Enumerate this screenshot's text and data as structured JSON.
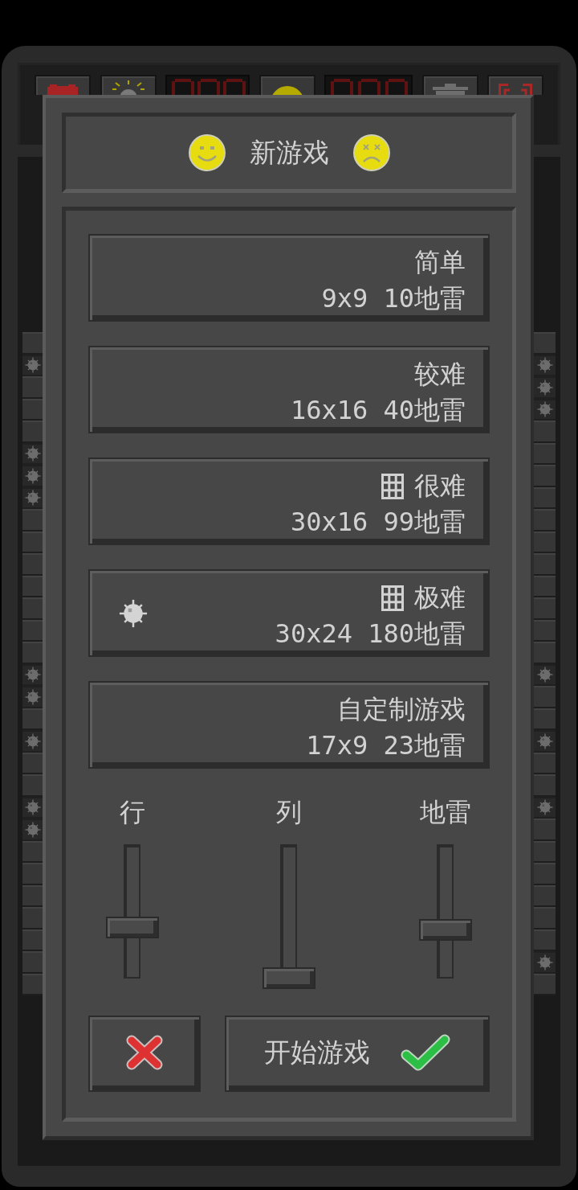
{
  "board": {
    "left_column": [
      {
        "mine": false
      },
      {
        "mine": true
      },
      {
        "mine": false
      },
      {
        "mine": false
      },
      {
        "mine": false
      },
      {
        "mine": true
      },
      {
        "mine": true
      },
      {
        "mine": true
      },
      {
        "mine": false
      },
      {
        "mine": false
      },
      {
        "mine": false
      },
      {
        "mine": false
      },
      {
        "mine": false
      },
      {
        "mine": false
      },
      {
        "mine": false
      },
      {
        "mine": true
      },
      {
        "mine": true
      },
      {
        "mine": false
      },
      {
        "mine": true
      },
      {
        "mine": false
      },
      {
        "mine": false
      },
      {
        "mine": true
      },
      {
        "mine": true
      },
      {
        "mine": false
      },
      {
        "mine": false
      },
      {
        "mine": false
      },
      {
        "mine": false
      },
      {
        "mine": false
      },
      {
        "mine": false
      },
      {
        "mine": false
      }
    ],
    "right_column": [
      {
        "mine": false
      },
      {
        "mine": true
      },
      {
        "mine": true
      },
      {
        "mine": true
      },
      {
        "mine": false
      },
      {
        "mine": false
      },
      {
        "mine": false
      },
      {
        "mine": false
      },
      {
        "mine": false
      },
      {
        "mine": false
      },
      {
        "mine": false
      },
      {
        "mine": false
      },
      {
        "mine": false
      },
      {
        "mine": false
      },
      {
        "mine": false
      },
      {
        "mine": true
      },
      {
        "mine": false
      },
      {
        "mine": false
      },
      {
        "mine": true
      },
      {
        "mine": false
      },
      {
        "mine": false
      },
      {
        "mine": true
      },
      {
        "mine": false
      },
      {
        "mine": false
      },
      {
        "mine": false
      },
      {
        "mine": false
      },
      {
        "mine": false
      },
      {
        "mine": false
      },
      {
        "mine": true
      },
      {
        "mine": false
      }
    ]
  },
  "dialog": {
    "title": "新游戏",
    "difficulties": [
      {
        "name": "简单",
        "size": "9x9 10地雷",
        "grid": false,
        "selected": false
      },
      {
        "name": "较难",
        "size": "16x16 40地雷",
        "grid": false,
        "selected": false
      },
      {
        "name": "很难",
        "size": "30x16 99地雷",
        "grid": true,
        "selected": false
      },
      {
        "name": "极难",
        "size": "30x24 180地雷",
        "grid": true,
        "selected": true
      },
      {
        "name": "自定制游戏",
        "size": "17x9 23地雷",
        "grid": false,
        "selected": false
      }
    ],
    "sliders": [
      {
        "label": "行",
        "level": 0.38
      },
      {
        "label": "列",
        "level": 0
      },
      {
        "label": "地雷",
        "level": 0.36
      }
    ],
    "buttons": [
      {
        "kind": "cancel"
      },
      {
        "kind": "start",
        "label": "开始游戏"
      }
    ]
  }
}
